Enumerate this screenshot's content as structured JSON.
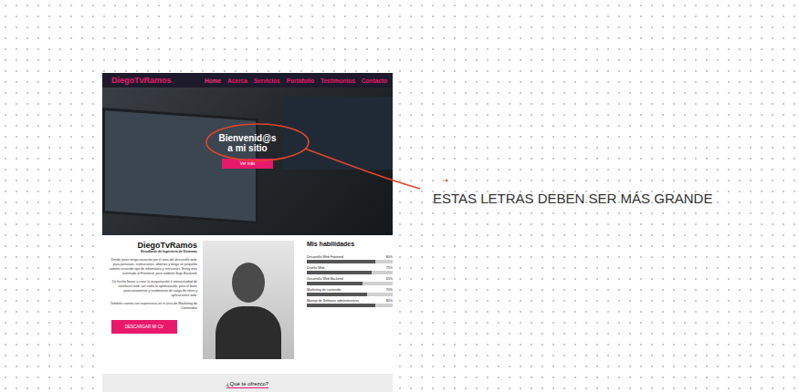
{
  "site": {
    "brand": "DiegoTvRamos",
    "nav": [
      {
        "label": "Home",
        "selected": true
      },
      {
        "label": "Acerca",
        "selected": false
      },
      {
        "label": "Servicios",
        "selected": false
      },
      {
        "label": "Portafolio",
        "selected": false
      },
      {
        "label": "Testimonios",
        "selected": false
      },
      {
        "label": "Contacto",
        "selected": false
      }
    ],
    "hero": {
      "title": "Bienvenid@s a mi sitio",
      "button": "Ver más"
    },
    "about": {
      "name": "DiegoTvRamos",
      "subtitle": "Estudiante de Ingeniería de Sistemas",
      "paragraphs": [
        "Desde joven tengo vocación por el área del desarrollo web, para personas, instituciones, abiertas y tengo un pequeño camino recorrido tipo de informática y relevantes. Estoy más orientado al Frontend, pero también llego Backend.",
        "De hecho forzar a crear la maquetación e interactividad de interfaces web, así como la optimización, para el buen posicionamiento y rendimiento de carga de sitios y aplicaciones web.",
        "También cuento con experiencia en el área de Marketing de Contenidos"
      ],
      "cv_button": "DESCARGAR MI CV"
    },
    "skills": {
      "title": "Mis habilidades",
      "items": [
        {
          "name": "Desarrollo Web Frontend",
          "reading": "80%",
          "level": 0.8
        },
        {
          "name": "Diseño Web",
          "reading": "75%",
          "level": 0.75
        },
        {
          "name": "Desarrollo Web Backend",
          "reading": "65%",
          "level": 0.65
        },
        {
          "name": "Marketing de contenido",
          "reading": "70%",
          "level": 0.7
        },
        {
          "name": "Manejo de Software administrativos",
          "reading": "80%",
          "level": 0.8
        }
      ]
    },
    "next_section": {
      "title": "¿Qué te ofrezco?"
    }
  },
  "annotation": {
    "note": "ESTAS LETRAS DEBEN SER MÁS GRANDE"
  }
}
